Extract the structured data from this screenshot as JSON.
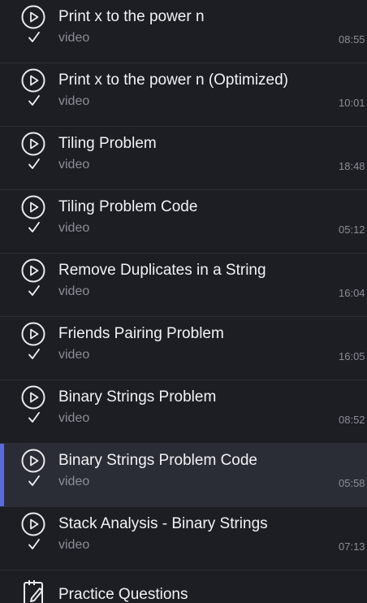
{
  "lessons": [
    {
      "title": "Print x to the power n",
      "type": "video",
      "duration": "08:55"
    },
    {
      "title": "Print x to the power n (Optimized)",
      "type": "video",
      "duration": "10:01"
    },
    {
      "title": "Tiling Problem",
      "type": "video",
      "duration": "18:48"
    },
    {
      "title": "Tiling Problem Code",
      "type": "video",
      "duration": "05:12"
    },
    {
      "title": "Remove Duplicates in a String",
      "type": "video",
      "duration": "16:04"
    },
    {
      "title": "Friends Pairing Problem",
      "type": "video",
      "duration": "16:05"
    },
    {
      "title": "Binary Strings Problem",
      "type": "video",
      "duration": "08:52"
    },
    {
      "title": "Binary Strings Problem Code",
      "type": "video",
      "duration": "05:58"
    },
    {
      "title": "Stack Analysis - Binary Strings",
      "type": "video",
      "duration": "07:13"
    }
  ],
  "practice": {
    "title": "Practice Questions",
    "icon": "notepad-pencil-icon"
  },
  "icons": {
    "play": "play-circle-icon",
    "completed": "checkmark-icon"
  },
  "colors": {
    "background": "#1c1e24",
    "active_row": "#2a2d35",
    "accent": "#5b6cd9"
  }
}
